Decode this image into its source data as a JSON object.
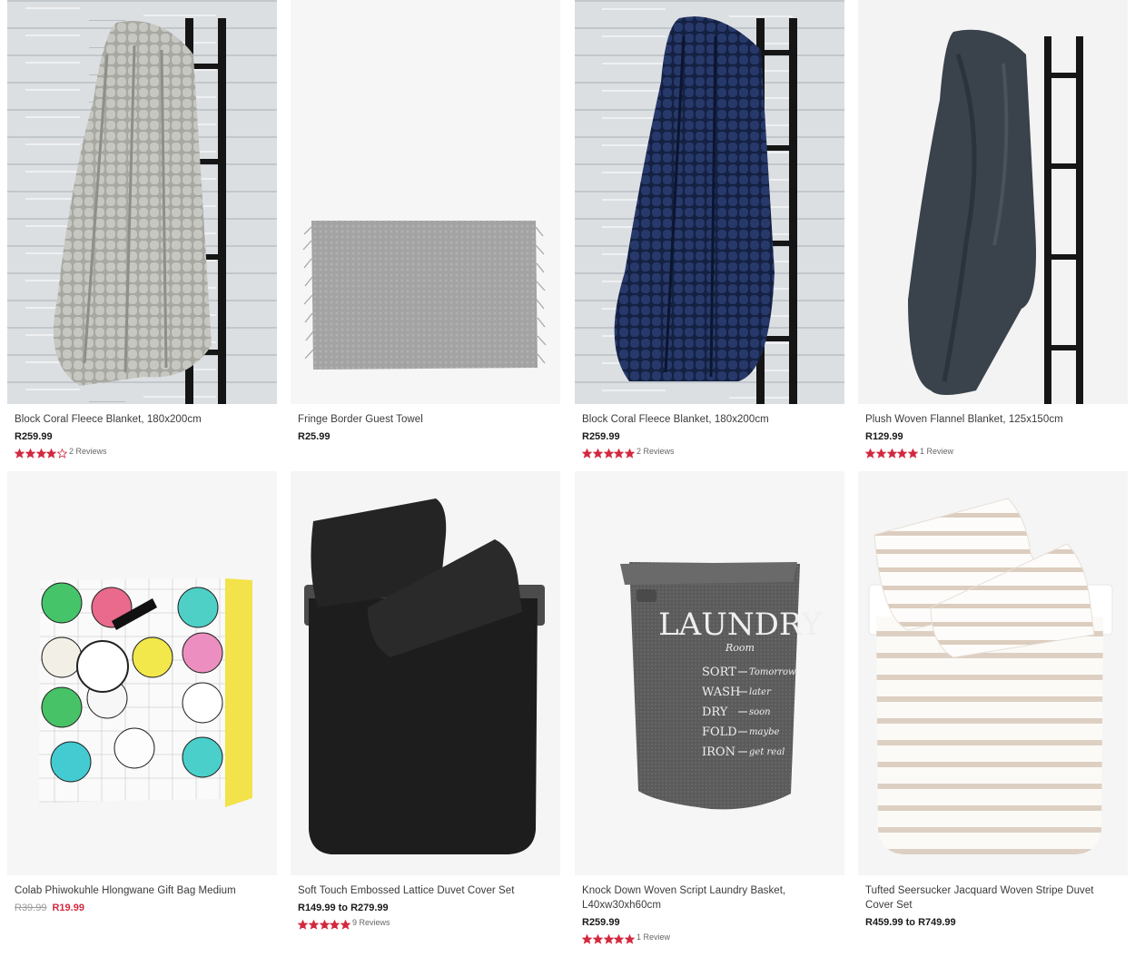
{
  "accent_color": "#d3293f",
  "products": [
    {
      "title": "Block Coral Fleece Blanket, 180x200cm",
      "price": "R259.99",
      "rating": 4,
      "reviews": "2 Reviews",
      "image": "grey-checked-blanket-on-ladder"
    },
    {
      "title": "Fringe Border Guest Towel",
      "price": "R25.99",
      "image": "grey-fringed-towel"
    },
    {
      "title": "Block Coral Fleece Blanket, 180x200cm",
      "price": "R259.99",
      "rating": 5,
      "reviews": "2 Reviews",
      "image": "navy-checked-blanket-on-ladder"
    },
    {
      "title": "Plush Woven Flannel Blanket, 125x150cm",
      "price": "R129.99",
      "rating": 5,
      "reviews": "1 Review",
      "image": "charcoal-flannel-blanket-on-ladder"
    },
    {
      "title": "Colab Phiwokuhle Hlongwane Gift Bag Medium",
      "was_price": "R39.99",
      "sale_price": "R19.99",
      "image": "illustrated-gift-bag"
    },
    {
      "title": "Soft Touch Embossed Lattice Duvet Cover Set",
      "price": "R149.99 to R279.99",
      "rating": 5,
      "reviews": "9 Reviews",
      "image": "black-duvet-set"
    },
    {
      "title": "Knock Down Woven Script Laundry Basket, L40xw30xh60cm",
      "price": "R259.99",
      "rating": 5,
      "reviews": "1 Review",
      "image": "grey-laundry-basket",
      "basket_text": {
        "brand": "LAUNDRY",
        "sub": "Room",
        "rows": [
          {
            "word": "SORT",
            "note": "Tomorrow"
          },
          {
            "word": "WASH",
            "note": "later"
          },
          {
            "word": "DRY",
            "note": "soon"
          },
          {
            "word": "FOLD",
            "note": "maybe"
          },
          {
            "word": "IRON",
            "note": "get real"
          }
        ]
      }
    },
    {
      "title": "Tufted Seersucker Jacquard Woven Stripe Duvet Cover Set",
      "price": "R459.99 to R749.99",
      "image": "stripe-duvet-set"
    }
  ]
}
